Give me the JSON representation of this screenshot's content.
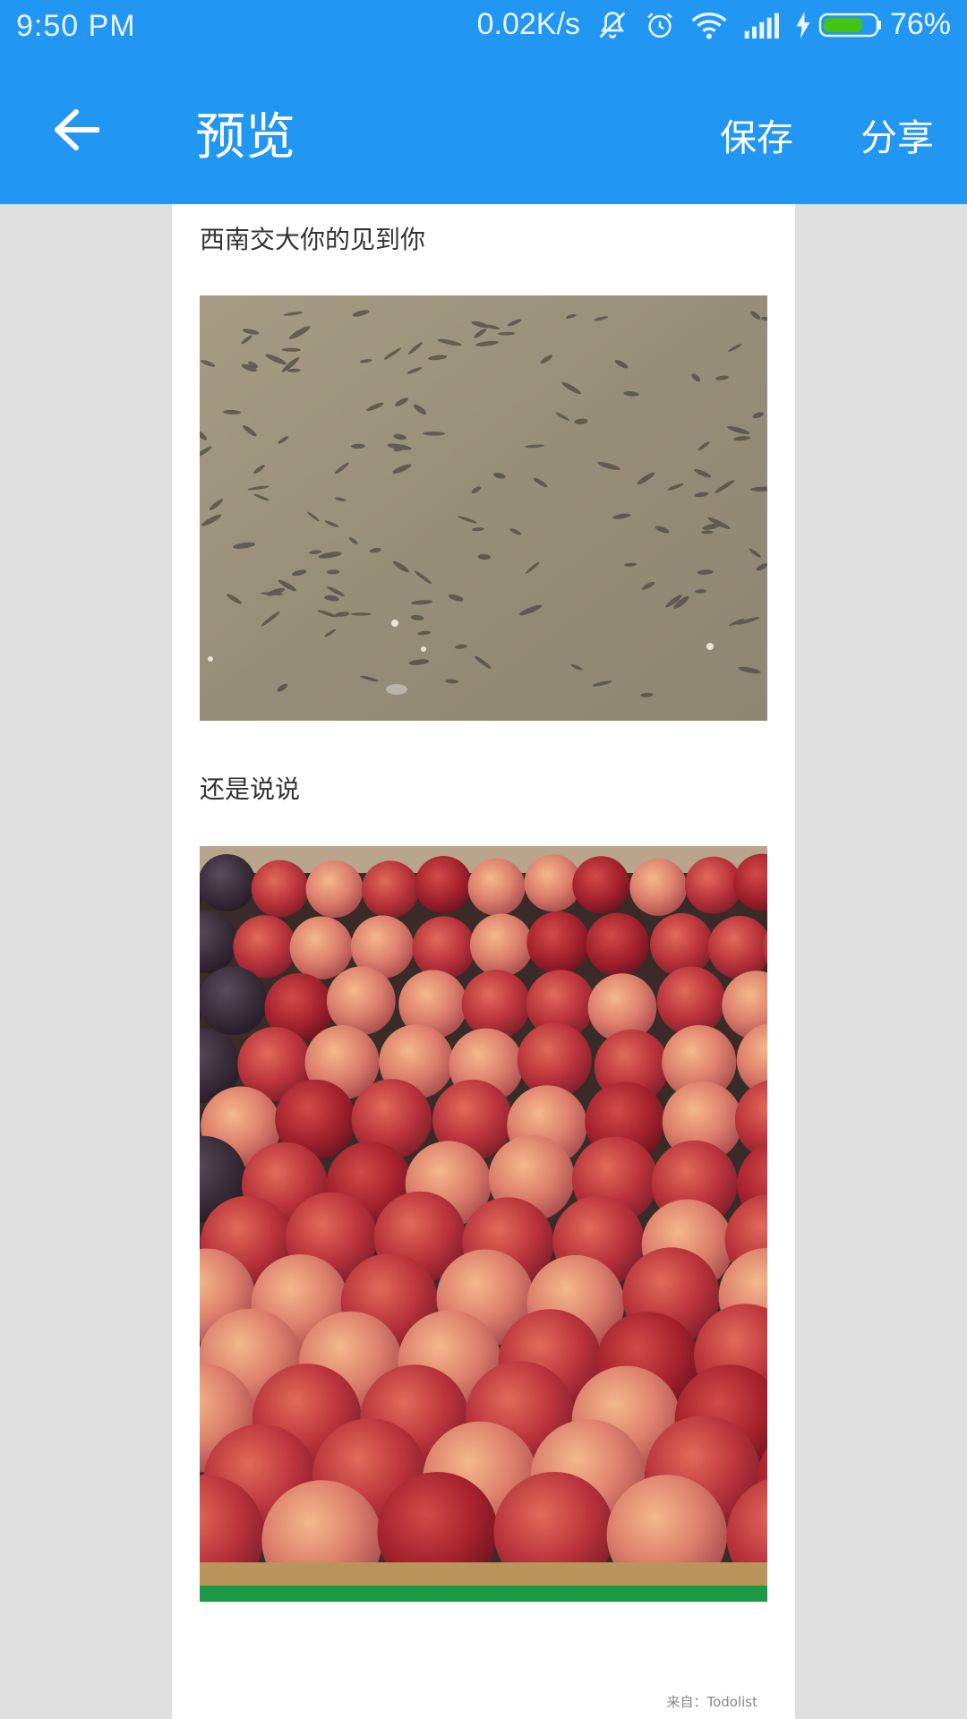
{
  "status_bar": {
    "time": "9:50  PM",
    "net_speed": "0.02K/s",
    "battery_percent": "76%",
    "battery_level": 0.76,
    "icons": [
      "mute-icon",
      "alarm-icon",
      "wifi-icon",
      "signal-icon",
      "charging-icon",
      "battery-icon"
    ]
  },
  "toolbar": {
    "title": "预览",
    "save_label": "保存",
    "share_label": "分享",
    "accent_color": "#2196f3"
  },
  "content": {
    "paragraph1": "西南交大你的见到你",
    "image1_desc": "fish-in-water-photo",
    "paragraph2": "还是说说",
    "image2_desc": "red-plums-photo",
    "footer": "来自：Todolist"
  }
}
